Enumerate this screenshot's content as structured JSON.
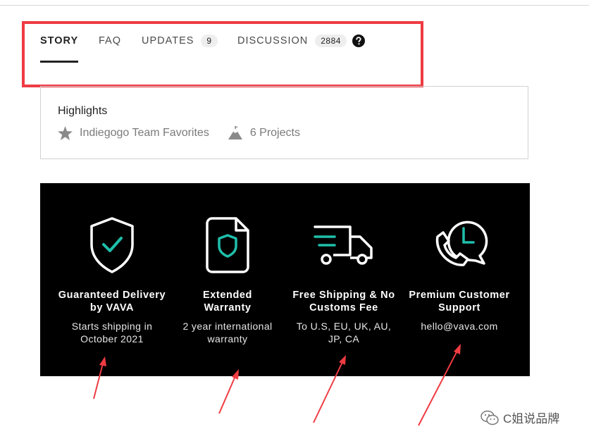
{
  "tabs": [
    {
      "label": "STORY",
      "active": true
    },
    {
      "label": "FAQ"
    },
    {
      "label": "UPDATES",
      "count": "9"
    },
    {
      "label": "DISCUSSION",
      "count": "2884"
    }
  ],
  "highlights": {
    "title": "Highlights",
    "items": [
      {
        "icon": "star-icon",
        "label": "Indiegogo Team Favorites"
      },
      {
        "icon": "mountain-icon",
        "label": "6 Projects"
      }
    ]
  },
  "features": [
    {
      "icon": "shield-check-icon",
      "title_line1": "Guaranteed Delivery",
      "title_line2": "by VAVA",
      "desc_line1": "Starts shipping in",
      "desc_line2": "October 2021"
    },
    {
      "icon": "warranty-document-icon",
      "title_line1": "Extended",
      "title_line2": "Warranty",
      "desc_line1": "2 year international",
      "desc_line2": "warranty"
    },
    {
      "icon": "delivery-truck-icon",
      "title_line1": "Free Shipping & No",
      "title_line2": "Customs Fee",
      "desc_line1": "To U.S, EU, UK, AU,",
      "desc_line2": "JP, CA"
    },
    {
      "icon": "phone-clock-icon",
      "title_line1": "Premium Customer",
      "title_line2": "Support",
      "desc_line1": "hello@vava.com",
      "desc_line2": ""
    }
  ],
  "watermark": {
    "text": "C姐说品牌",
    "icon": "wechat-icon"
  },
  "colors": {
    "accent": "#1fbfaa",
    "annotation": "#ef3b42",
    "panel": "#000000"
  }
}
